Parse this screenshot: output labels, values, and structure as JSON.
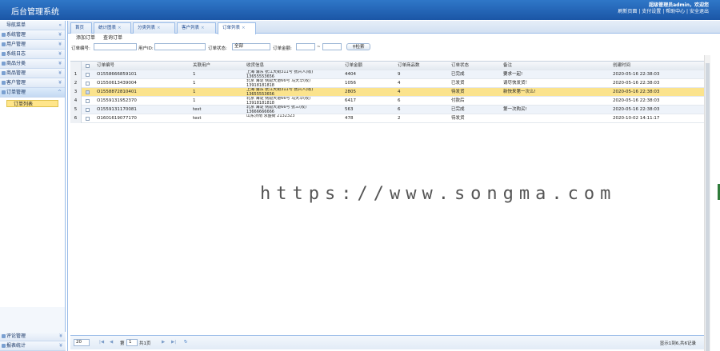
{
  "app": {
    "title": "后台管理系统"
  },
  "user": {
    "greeting_line1": "超级管理员admin，欢迎您",
    "links": [
      "刷新页面",
      "支付设置",
      "帮助中心",
      "安全退出"
    ]
  },
  "sidebar": {
    "header": "导航菜单",
    "items": [
      {
        "label": "系统管理"
      },
      {
        "label": "用户管理"
      },
      {
        "label": "系统日志"
      },
      {
        "label": "商品分类"
      },
      {
        "label": "商品管理"
      },
      {
        "label": "客户管理"
      },
      {
        "label": "订单管理"
      }
    ],
    "subitem": "订单列表",
    "footer": [
      {
        "label": "评论管理"
      },
      {
        "label": "报表统计"
      }
    ]
  },
  "tabs": [
    "首页",
    "统计图表",
    "分类列表",
    "客户列表",
    "订单列表"
  ],
  "toolbar": {
    "a": "添加订单",
    "b": "查询订单"
  },
  "filter": {
    "l1": "订单编号:",
    "l2": "用户ID:",
    "l3": "订单状态:",
    "status": "全部",
    "l4": "订单金额:",
    "sep": "~",
    "btn": "检索"
  },
  "columns": [
    "订单编号",
    "关联用户",
    "收货信息",
    "订单金额",
    "订单商品数",
    "订单状态",
    "备注",
    "创建时间"
  ],
  "rows": [
    {
      "n": "1",
      "id": "O1558666859101",
      "user": "1",
      "addr1": "上海 浦东 张江大街311号 张兴人(收)",
      "addr2": "13655553656",
      "amt": "4404",
      "cnt": "9",
      "st": "已完成",
      "note": "要求一起!",
      "time": "2020-05-16 22:38:03"
    },
    {
      "n": "2",
      "id": "O1550613439004",
      "user": "1",
      "addr1": "北京 海淀 侧窟大道66号 马天华(收)",
      "addr2": "13918181818",
      "amt": "1056",
      "cnt": "4",
      "st": "已发货",
      "note": "请尽快发货！",
      "time": "2020-05-16 22:38:03"
    },
    {
      "n": "3",
      "id": "O1558872810401",
      "user": "1",
      "addr1": "上海 浦东 张江大街311号 张兴人(收)",
      "addr2": "13655553656",
      "amt": "2805",
      "cnt": "4",
      "st": "待发货",
      "note": "新快来第一次么!",
      "time": "2020-05-16 22:38:03"
    },
    {
      "n": "4",
      "id": "O1559131952370",
      "user": "1",
      "addr1": "北京 海淀 侧窟大道66号 马天华(收)",
      "addr2": "13918181818",
      "amt": "6417",
      "cnt": "6",
      "st": "付款后",
      "note": "",
      "time": "2020-05-16 22:38:03"
    },
    {
      "n": "5",
      "id": "O1559131170081",
      "user": "test",
      "addr1": "北京 海淀 侧窟大道66号 张三(收)",
      "addr2": "13666666666",
      "amt": "563",
      "cnt": "6",
      "st": "已完成",
      "note": "第一次购买!",
      "time": "2020-05-16 22:38:03"
    },
    {
      "n": "6",
      "id": "O1601619077170",
      "user": "test",
      "addr1": "山东济南 永盛街 2132323",
      "addr2": "",
      "amt": "478",
      "cnt": "2",
      "st": "待发货",
      "note": "",
      "time": "2020-10-02 14:11:17"
    }
  ],
  "pager": {
    "size": "20",
    "page_label_a": "第",
    "page": "1",
    "page_label_b": "共1页",
    "info": "显示1到6,共6记录"
  },
  "watermark": "https://www.songma.com"
}
